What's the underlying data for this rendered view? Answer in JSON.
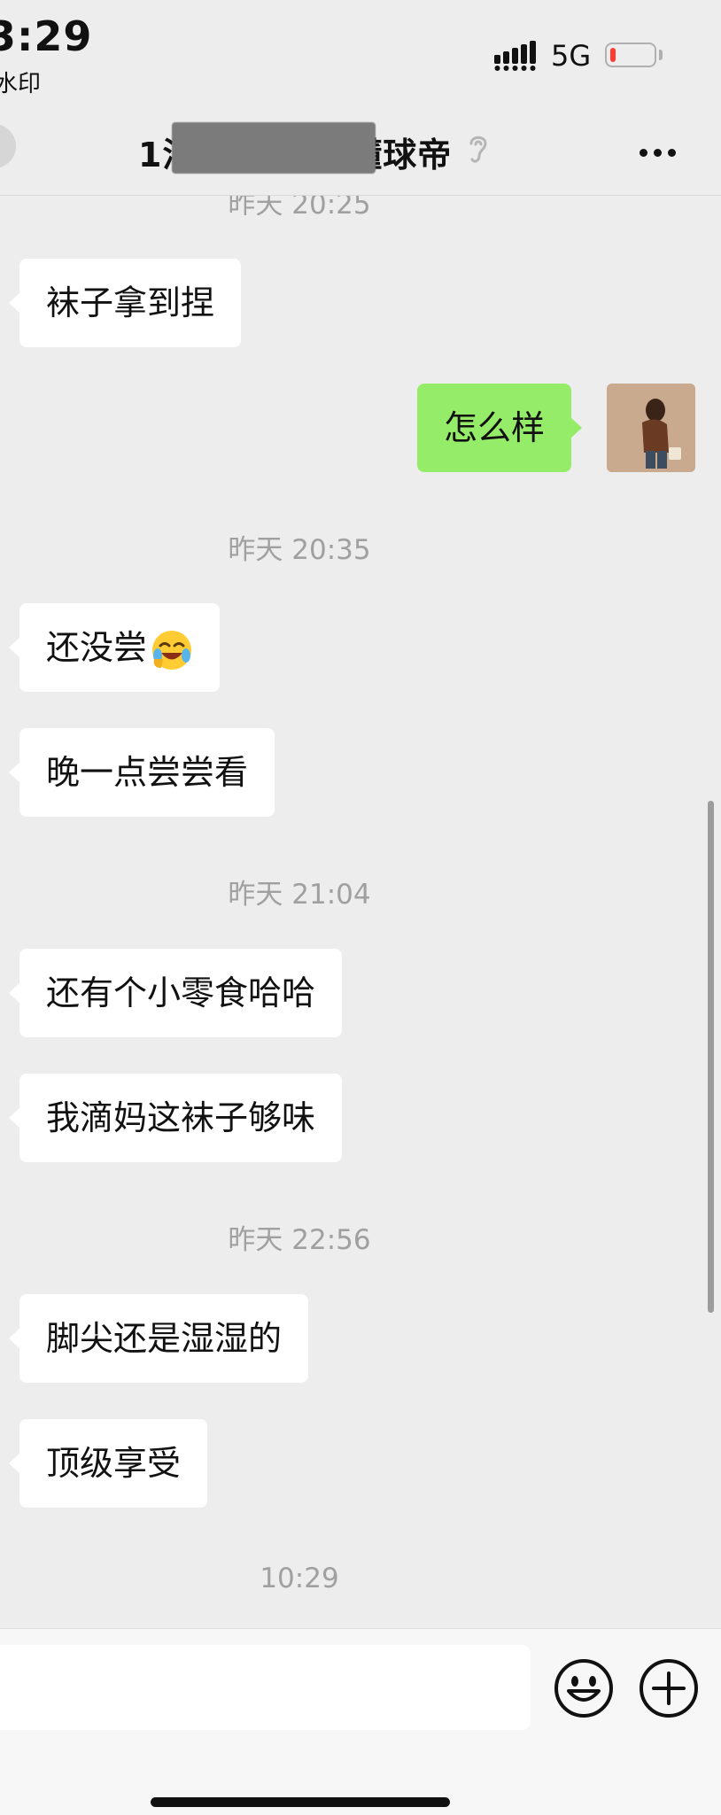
{
  "status_bar": {
    "time": "3:29",
    "sub_label": "水印",
    "network": "5G",
    "battery_level": 0.12,
    "battery_color": "#ff3b30"
  },
  "nav": {
    "title": "1涉            懂球帝",
    "icons": [
      "back-icon",
      "ear-icon",
      "more-icon"
    ]
  },
  "messages": [
    {
      "type": "timestamp",
      "text": "昨天 20:25"
    },
    {
      "type": "in",
      "text": "袜子拿到捏"
    },
    {
      "type": "out",
      "text": "怎么样"
    },
    {
      "type": "timestamp",
      "text": "昨天 20:35"
    },
    {
      "type": "in",
      "text": "还没尝",
      "emoji": "laughing-crying-emoji"
    },
    {
      "type": "in",
      "text": "晚一点尝尝看"
    },
    {
      "type": "timestamp",
      "text": "昨天 21:04"
    },
    {
      "type": "in",
      "text": "还有个小零食哈哈"
    },
    {
      "type": "in",
      "text": "我滴妈这袜子够味"
    },
    {
      "type": "timestamp",
      "text": "昨天 22:56"
    },
    {
      "type": "in",
      "text": "脚尖还是湿湿的"
    },
    {
      "type": "in",
      "text": "顶级享受"
    },
    {
      "type": "timestamp",
      "text": "10:29"
    }
  ],
  "colors": {
    "background": "#ededed",
    "incoming_bubble": "#ffffff",
    "outgoing_bubble": "#95ec69",
    "timestamp_text": "#a0a0a0"
  },
  "input_bar": {
    "value": "",
    "icons": [
      "emoji-icon",
      "plus-icon"
    ]
  }
}
